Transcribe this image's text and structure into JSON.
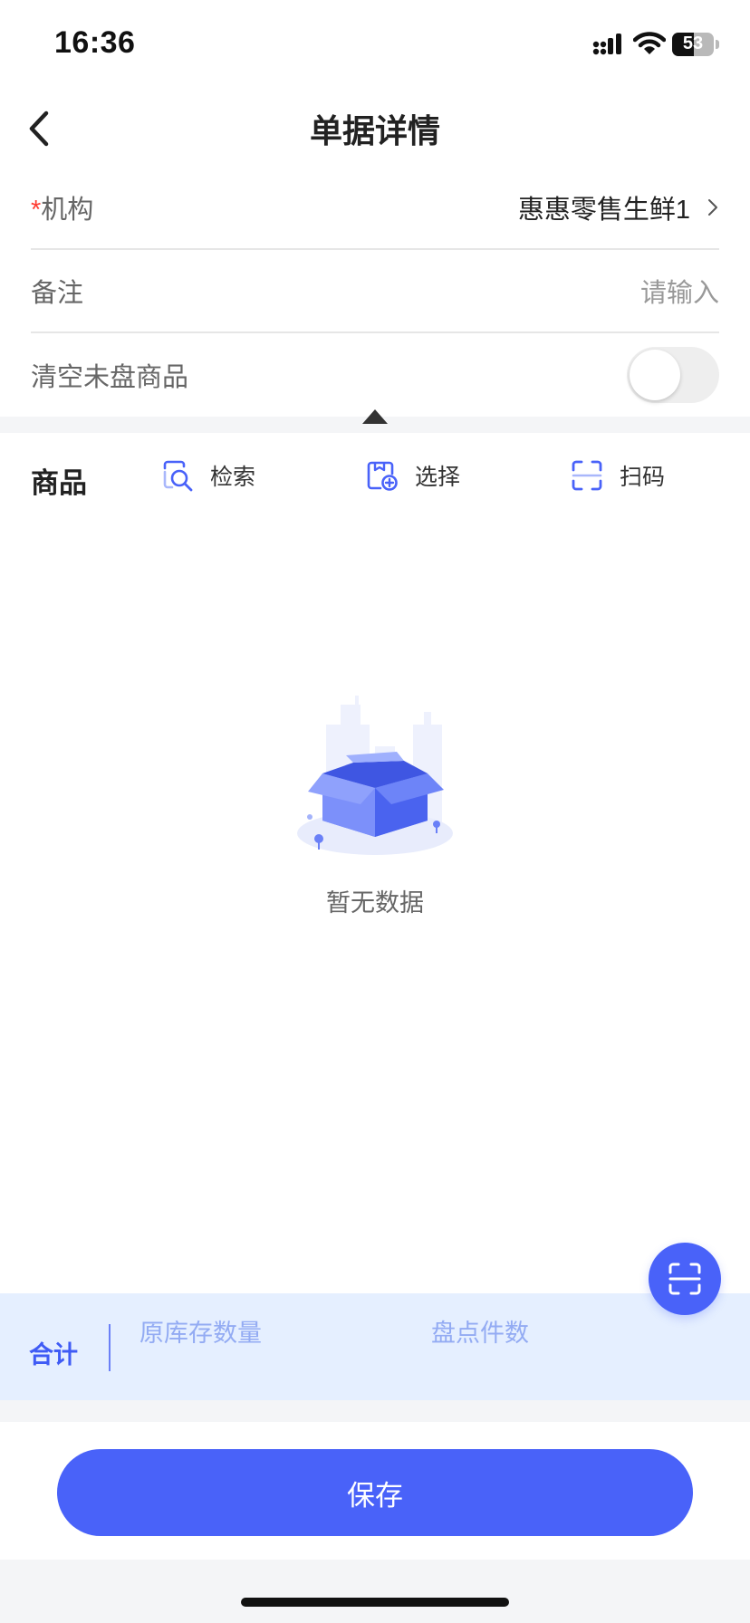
{
  "status_bar": {
    "time": "16:36",
    "battery": "53"
  },
  "header": {
    "title": "单据详情"
  },
  "form": {
    "org": {
      "required_mark": "*",
      "label": "机构",
      "value": "惠惠零售生鲜1"
    },
    "remark": {
      "label": "备注",
      "placeholder": "请输入"
    },
    "clear_uncounted": {
      "label": "清空未盘商品",
      "enabled": false
    }
  },
  "goods": {
    "title": "商品",
    "tools": {
      "search": "检索",
      "select": "选择",
      "scan": "扫码"
    },
    "empty_text": "暂无数据"
  },
  "summary": {
    "label": "合计",
    "columns": {
      "original_stock": "原库存数量",
      "count_qty": "盘点件数"
    }
  },
  "actions": {
    "save": "保存"
  },
  "colors": {
    "accent": "#4962f9",
    "summary_bg": "#e5efff",
    "required": "#ff3b30"
  },
  "icons": [
    "back-chevron-icon",
    "chevron-right-icon",
    "search-icon",
    "select-add-icon",
    "scan-icon",
    "empty-box-icon"
  ]
}
